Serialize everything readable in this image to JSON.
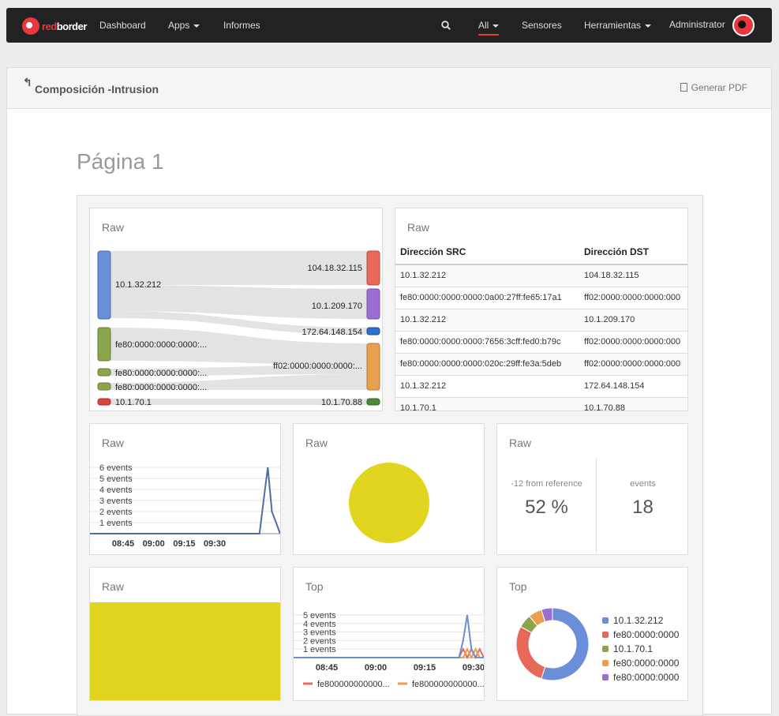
{
  "navbar": {
    "brand_red": "red",
    "brand_rest": "border",
    "items": [
      "Dashboard",
      "Apps",
      "Informes"
    ],
    "filter": "All",
    "sensors": "Sensores",
    "tools": "Herramientas",
    "user": "Administrator"
  },
  "header": {
    "title": "Composición -Intrusion",
    "pdf": "Generar PDF"
  },
  "page_title": "Página 1",
  "sankey": {
    "title": "Raw",
    "left_nodes": [
      "10.1.32.212",
      "fe80:0000:0000:0000:...",
      "fe80:0000:0000:0000:...",
      "fe80:0000:0000:0000:...",
      "10.1.70.1"
    ],
    "right_nodes": [
      "104.18.32.115",
      "10.1.209.170",
      "172.64.148.154",
      "ff02:0000:0000:0000:...",
      "10.1.70.88"
    ],
    "colors": [
      "#6a8fd8",
      "#8aa54b",
      "#8aa54b",
      "#8aa54b",
      "#d9463e",
      "#e8685a",
      "#9b6ed4",
      "#2f6fcf",
      "#e8a04e",
      "#4a8a3a"
    ]
  },
  "table": {
    "title": "Raw",
    "headers": [
      "Dirección SRC",
      "Dirección DST"
    ],
    "rows": [
      [
        "10.1.32.212",
        "104.18.32.115"
      ],
      [
        "fe80:0000:0000:0000:0a00:27ff:fe65:17a1",
        "ff02:0000:0000:0000:000"
      ],
      [
        "10.1.32.212",
        "10.1.209.170"
      ],
      [
        "fe80:0000:0000:0000:7656:3cff:fed0:b79c",
        "ff02:0000:0000:0000:000"
      ],
      [
        "fe80:0000:0000:0000:020c:29ff:fe3a:5deb",
        "ff02:0000:0000:0000:000"
      ],
      [
        "10.1.32.212",
        "172.64.148.154"
      ],
      [
        "10.1.70.1",
        "10.1.70.88"
      ]
    ]
  },
  "events_chart": {
    "title": "Raw",
    "chart_data": {
      "type": "line",
      "y_ticks": [
        "6 events",
        "5 events",
        "4 events",
        "3 events",
        "2 events",
        "1 events"
      ],
      "x_ticks": [
        "08:45",
        "09:00",
        "09:15",
        "09:30"
      ],
      "ylim": [
        0,
        6
      ],
      "series": [
        {
          "color": "#4e6fa3",
          "values": [
            0,
            0,
            0,
            0,
            0,
            0,
            0,
            0,
            0,
            0,
            0,
            0,
            0,
            0,
            0,
            0,
            0,
            0,
            0,
            0,
            0,
            0,
            0,
            0,
            0,
            0,
            0,
            0,
            0,
            0,
            0,
            0,
            0,
            0,
            0,
            0,
            0,
            0,
            0,
            0,
            0,
            0,
            3,
            6,
            2,
            1,
            0
          ]
        }
      ]
    }
  },
  "pie_chart": {
    "title": "Raw",
    "chart_data": {
      "type": "pie",
      "values": [
        100
      ],
      "colors": [
        "#e2d51f"
      ]
    }
  },
  "metric": {
    "title": "Raw",
    "ref_label": "-12 from reference",
    "ref_value": "52 %",
    "events_label": "events",
    "events_value": "18"
  },
  "color_block": {
    "title": "Raw",
    "color": "#e2d51f"
  },
  "top_events": {
    "title": "Top",
    "chart_data": {
      "type": "line",
      "y_ticks": [
        "5 events",
        "4 events",
        "3 events",
        "2 events",
        "1 events"
      ],
      "x_ticks": [
        "08:45",
        "09:00",
        "09:15",
        "09:30"
      ],
      "ylim": [
        0,
        5
      ],
      "series": [
        {
          "name": "fe800000000000...",
          "color": "#e8685a",
          "values": [
            0,
            0,
            0,
            0,
            0,
            0,
            0,
            0,
            0,
            0,
            0,
            0,
            0,
            0,
            0,
            0,
            0,
            0,
            0,
            0,
            0,
            0,
            0,
            0,
            0,
            0,
            0,
            0,
            0,
            0,
            0,
            0,
            0,
            0,
            0,
            0,
            0,
            0,
            0,
            0,
            0,
            1,
            0,
            1,
            0,
            1,
            0
          ]
        },
        {
          "name": "fe800000000000...",
          "color": "#e8a04e",
          "values": [
            0,
            0,
            0,
            0,
            0,
            0,
            0,
            0,
            0,
            0,
            0,
            0,
            0,
            0,
            0,
            0,
            0,
            0,
            0,
            0,
            0,
            0,
            0,
            0,
            0,
            0,
            0,
            0,
            0,
            0,
            0,
            0,
            0,
            0,
            0,
            0,
            0,
            0,
            0,
            0,
            0,
            0,
            1,
            0,
            1,
            0,
            0
          ]
        },
        {
          "name": "",
          "color": "#6a8fd8",
          "values": [
            0,
            0,
            0,
            0,
            0,
            0,
            0,
            0,
            0,
            0,
            0,
            0,
            0,
            0,
            0,
            0,
            0,
            0,
            0,
            0,
            0,
            0,
            0,
            0,
            0,
            0,
            0,
            0,
            0,
            0,
            0,
            0,
            0,
            0,
            0,
            0,
            0,
            0,
            0,
            0,
            0,
            2,
            5,
            1,
            0,
            0,
            0
          ]
        }
      ]
    }
  },
  "top_donut": {
    "title": "Top",
    "chart_data": {
      "type": "pie",
      "categories": [
        "10.1.32.212",
        "fe80:0000:0000",
        "10.1.70.1",
        "fe80:0000:0000",
        "fe80:0000:0000"
      ],
      "values": [
        55,
        28,
        6,
        6,
        5
      ],
      "colors": [
        "#6a8fd8",
        "#e8685a",
        "#8aa54b",
        "#e8a04e",
        "#9b6ed4"
      ]
    }
  }
}
